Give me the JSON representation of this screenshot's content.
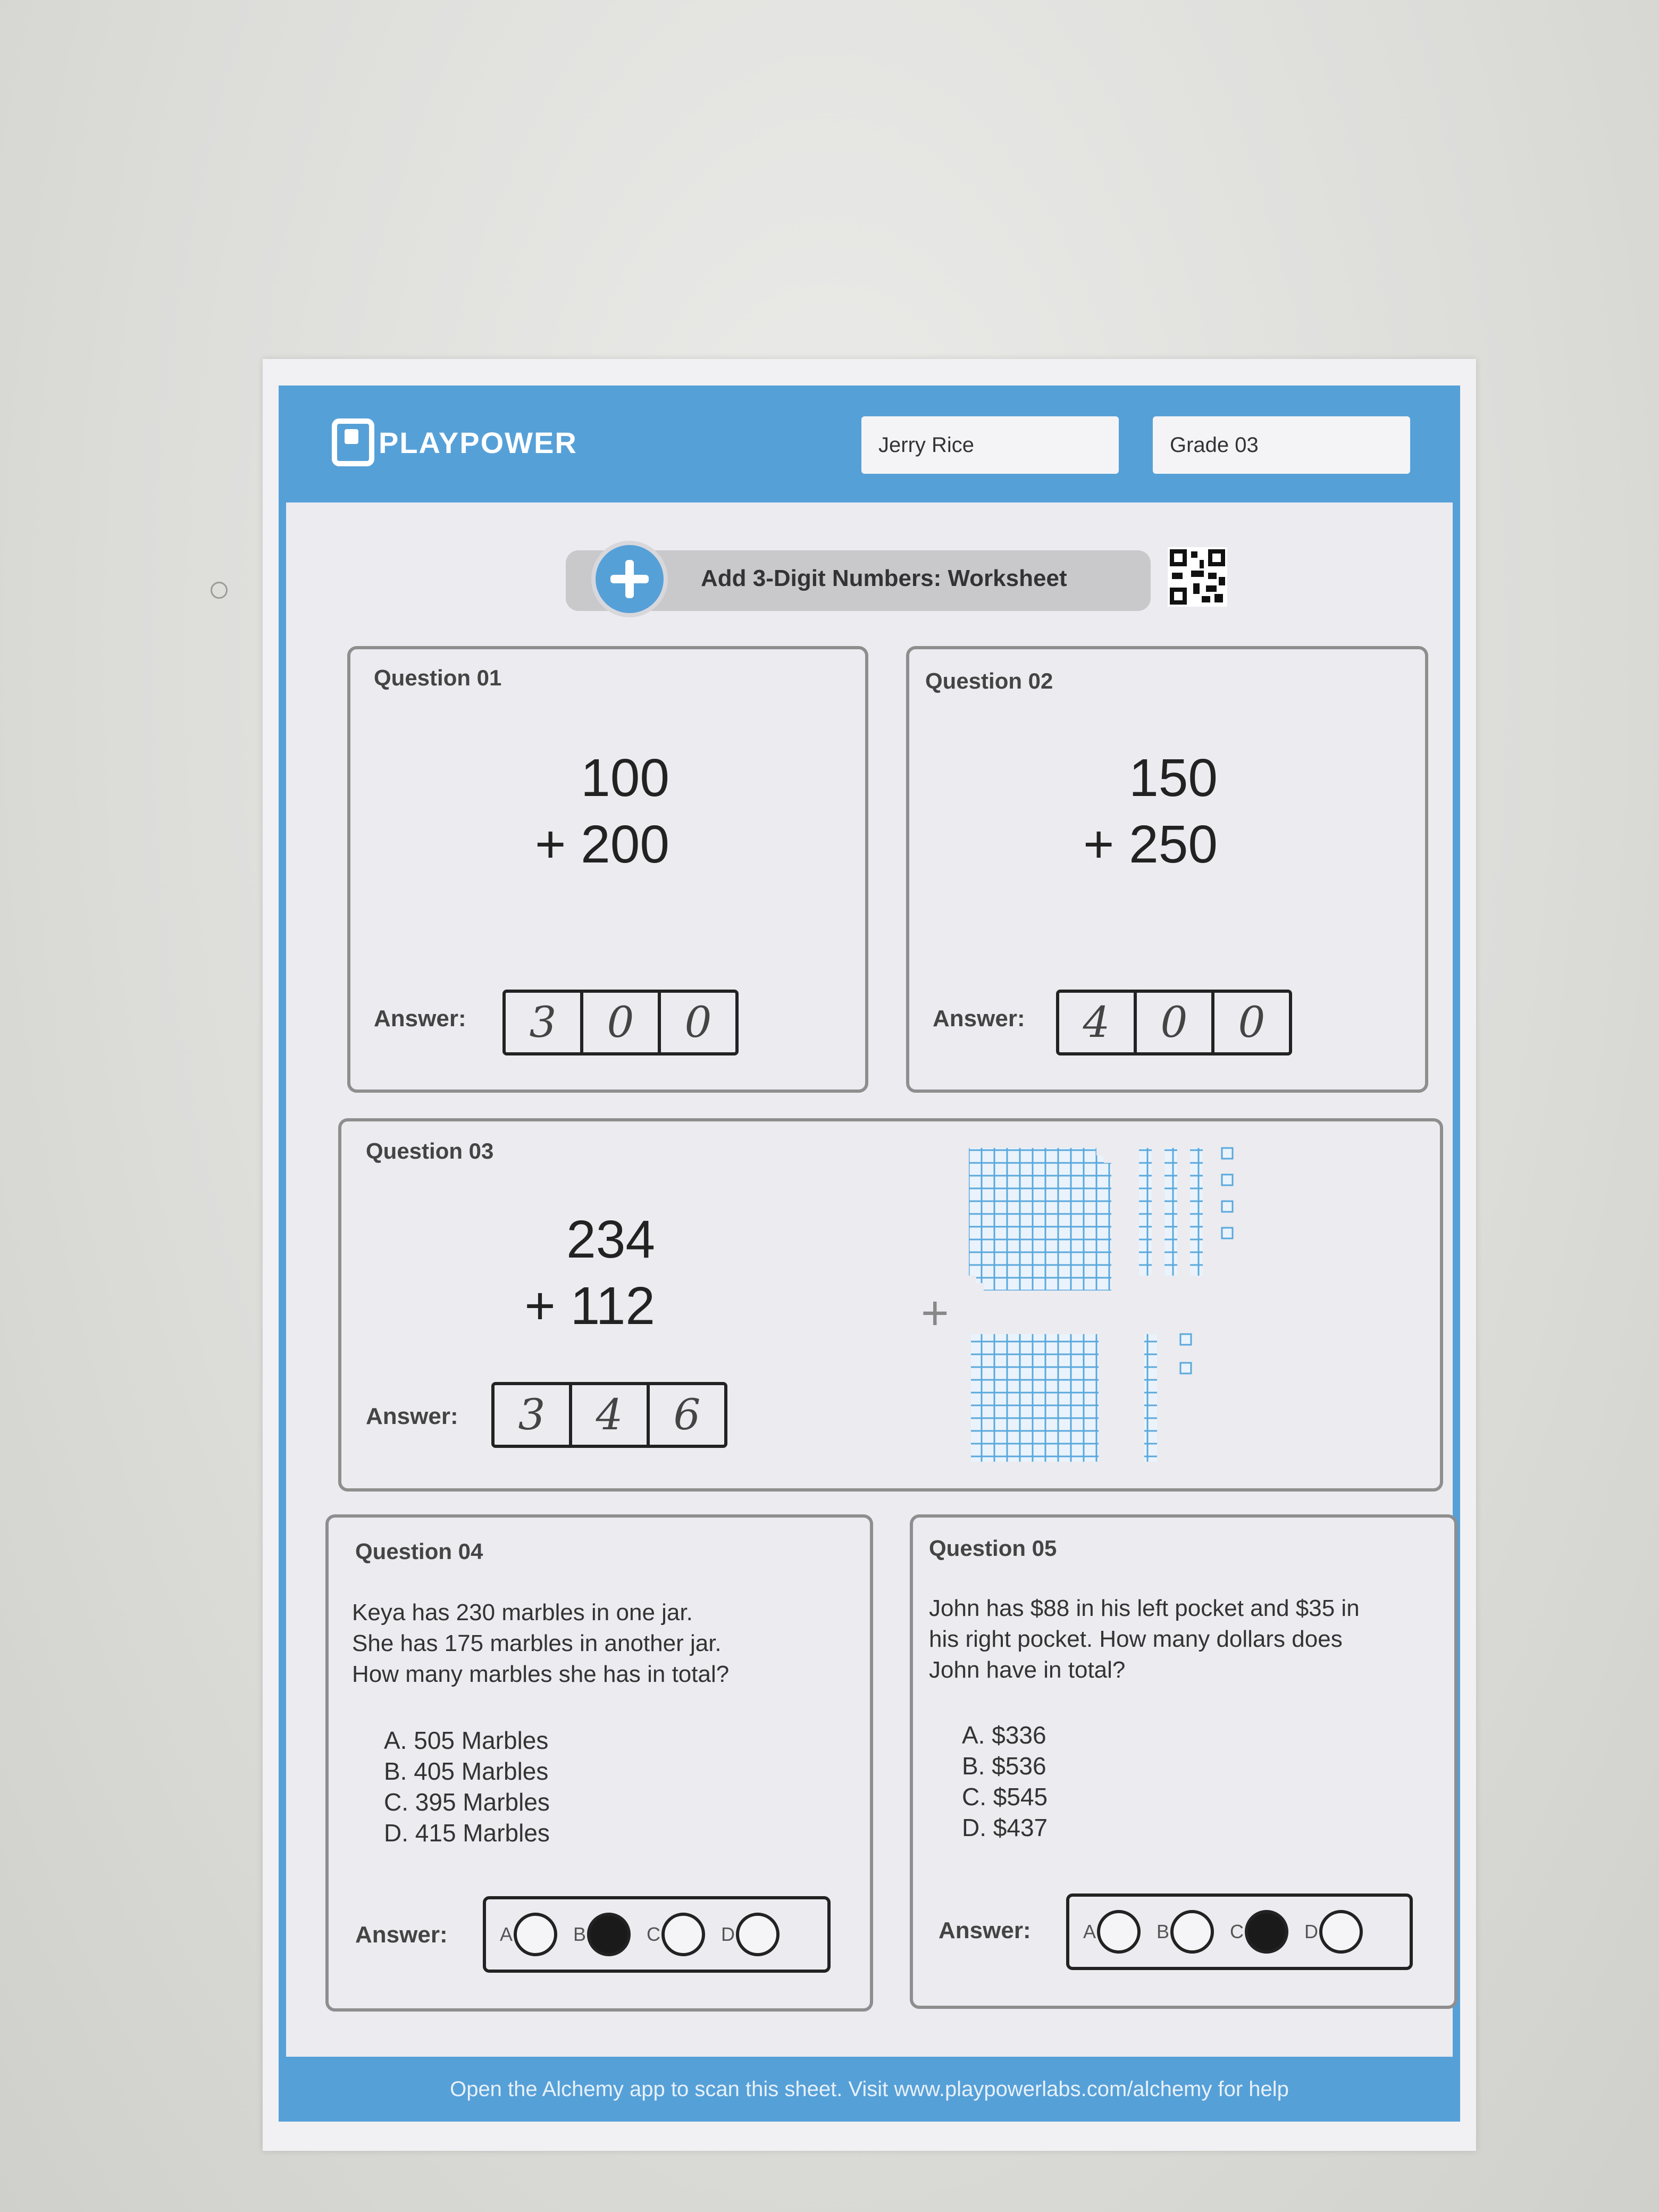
{
  "header": {
    "logo_text": "PLAYPOWER",
    "student_name": "Jerry Rice",
    "grade": "Grade 03"
  },
  "title": "Add 3-Digit Numbers: Worksheet",
  "questions": [
    {
      "label": "Question 01",
      "top": "100",
      "bottom": "+ 200",
      "answer_label": "Answer:",
      "digits": [
        "3",
        "0",
        "0"
      ]
    },
    {
      "label": "Question 02",
      "top": "150",
      "bottom": "+ 250",
      "answer_label": "Answer:",
      "digits": [
        "4",
        "0",
        "0"
      ]
    },
    {
      "label": "Question 03",
      "top": "234",
      "bottom": "+ 112",
      "answer_label": "Answer:",
      "digits": [
        "3",
        "4",
        "6"
      ],
      "plus": "+"
    },
    {
      "label": "Question 04",
      "prompt": [
        "Keya has 230 marbles in one jar.",
        "She has 175 marbles in another jar.",
        "How many marbles she has in total?"
      ],
      "options": [
        "A. 505 Marbles",
        "B. 405 Marbles",
        "C. 395 Marbles",
        "D. 415 Marbles"
      ],
      "answer_label": "Answer:",
      "bubbles": [
        "A",
        "B",
        "C",
        "D"
      ],
      "selected": "B"
    },
    {
      "label": "Question 05",
      "prompt": [
        "John has $88 in his left pocket and $35 in",
        "his right pocket. How many dollars does",
        "John have in total?"
      ],
      "options": [
        "A. $336",
        "B. $536",
        "C. $545",
        "D. $437"
      ],
      "answer_label": "Answer:",
      "bubbles": [
        "A",
        "B",
        "C",
        "D"
      ],
      "selected": "C"
    }
  ],
  "footer": "Open the Alchemy app to scan this sheet. Visit www.playpowerlabs.com/alchemy for help",
  "colors": {
    "brand_blue": "#56a0d8",
    "block_blue": "#5aa8dc"
  }
}
